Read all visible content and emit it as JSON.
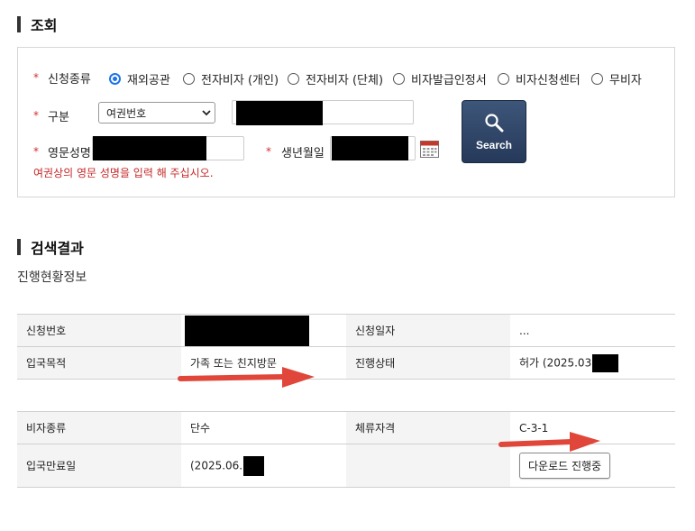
{
  "lookup_section": {
    "title": "조회"
  },
  "form": {
    "application_type_label": "신청종류",
    "application_type_options": [
      "재외공관",
      "전자비자 (개인)",
      "전자비자 (단체)",
      "비자발급인정서",
      "비자신청센터",
      "무비자"
    ],
    "application_type_selected": "재외공관",
    "category_label": "구분",
    "category_selected": "여권번호",
    "english_name_label": "영문성명",
    "birth_date_label": "생년월일",
    "hint": "여권상의 영문 성명을 입력 해 주십시오.",
    "required_mark": "*"
  },
  "search_button": {
    "label": "Search",
    "icon": "magnifier-icon"
  },
  "results_section": {
    "title": "검색결과",
    "subtitle": "진행현황정보"
  },
  "table1": {
    "rows": [
      {
        "h1": "신청번호",
        "v1": "",
        "h2": "신청일자",
        "v2": "..."
      },
      {
        "h1": "입국목적",
        "v1": "가족 또는 친지방문",
        "h2": "진행상태",
        "v2": "허가 (2025.03"
      }
    ]
  },
  "table2": {
    "rows": [
      {
        "h1": "비자종류",
        "v1": "단수",
        "h2": "체류자격",
        "v2": "C-3-1"
      },
      {
        "h1": "입국만료일",
        "v1": "(2025.06.",
        "h2": "",
        "download_label": "다운로드 진행중"
      }
    ]
  },
  "colors": {
    "accent_blue": "#1e73e8",
    "search_button": "#2f4467",
    "required_red": "#d32f2f",
    "annotation_arrow": "#e0463a"
  }
}
